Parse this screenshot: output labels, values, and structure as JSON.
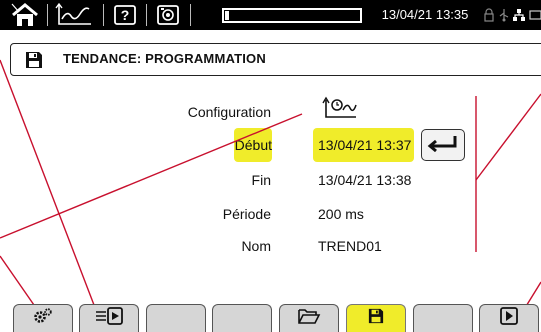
{
  "status_bar": {
    "icons": [
      "home-icon",
      "trend-icon",
      "help-icon",
      "screenshot-icon"
    ],
    "datetime": "13/04/21 13:35",
    "status_icons": [
      "lock-icon",
      "usb-icon",
      "network-icon",
      "battery-icon"
    ],
    "battery_level": 0.03
  },
  "title_bar": {
    "icon": "save-icon",
    "title": "TENDANCE: PROGRAMMATION"
  },
  "form": {
    "configuration_label": "Configuration",
    "configuration_icon": "trend-config-icon",
    "debut_label": "Début",
    "debut_value": "13/04/21 13:37",
    "enter_icon": "enter-icon",
    "fin_label": "Fin",
    "fin_value": "13/04/21 13:38",
    "periode_label": "Période",
    "periode_value": "200 ms",
    "nom_label": "Nom",
    "nom_value": "TREND01"
  },
  "function_keys": [
    {
      "icon": "settings-icon",
      "active": false
    },
    {
      "icon": "start-recording-icon",
      "active": false
    },
    {
      "icon": "",
      "active": false
    },
    {
      "icon": "",
      "active": false
    },
    {
      "icon": "open-folder-icon",
      "active": false
    },
    {
      "icon": "save-icon",
      "active": true
    },
    {
      "icon": "",
      "active": false
    },
    {
      "icon": "play-icon",
      "active": false
    }
  ],
  "colors": {
    "highlight": "#f0ec2a",
    "callout": "#c8102e",
    "status_bar": "#000000"
  }
}
